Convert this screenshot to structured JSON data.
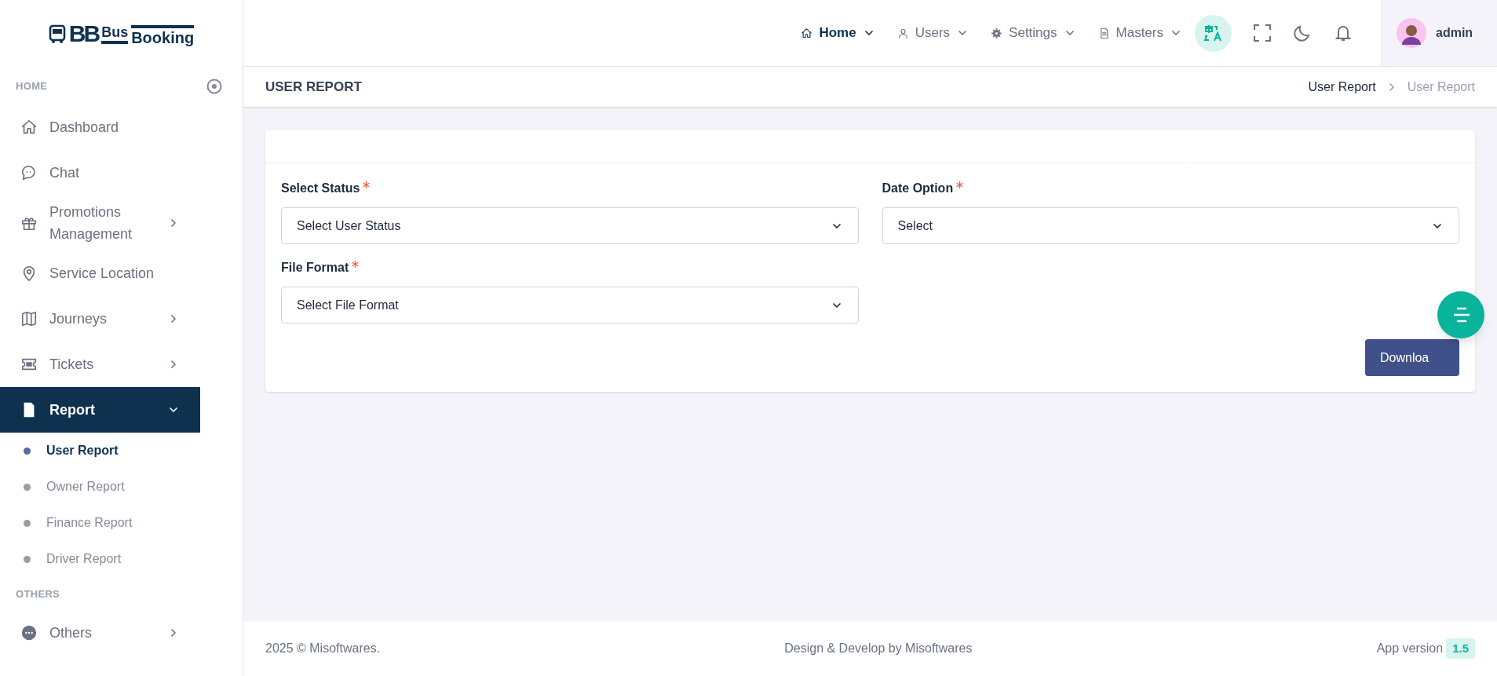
{
  "logo": {
    "mark": "BB",
    "word_top": "Bus",
    "word_bottom": "Booking"
  },
  "sidebar": {
    "sections": [
      {
        "title": "HOME",
        "items": [
          {
            "label": "Dashboard",
            "selected": false
          },
          {
            "label": "Chat",
            "selected": false
          },
          {
            "label": "Promotions Management",
            "expanded": false,
            "selected": false
          },
          {
            "label": "Service Location",
            "selected": false
          },
          {
            "label": "Journeys",
            "expanded": false,
            "selected": false
          },
          {
            "label": "Tickets",
            "expanded": false,
            "selected": false
          },
          {
            "label": "Report",
            "expanded": true,
            "selected": true,
            "children": [
              {
                "label": "User Report",
                "selected": true
              },
              {
                "label": "Owner Report",
                "selected": false
              },
              {
                "label": "Finance Report",
                "selected": false
              },
              {
                "label": "Driver Report",
                "selected": false
              }
            ]
          }
        ]
      },
      {
        "title": "OTHERS",
        "items": [
          {
            "label": "Others",
            "expanded": false,
            "selected": false
          }
        ]
      }
    ]
  },
  "topnav": {
    "menus": [
      {
        "label": "Home",
        "selected": true
      },
      {
        "label": "Users",
        "selected": false
      },
      {
        "label": "Settings",
        "selected": false
      },
      {
        "label": "Masters",
        "selected": false
      }
    ],
    "user": {
      "name": "admin"
    }
  },
  "page": {
    "title": "USER REPORT",
    "breadcrumb": [
      {
        "label": "User Report",
        "selected": false
      },
      {
        "label": "User Report",
        "selected": true
      }
    ]
  },
  "form": {
    "fields": [
      {
        "label": "Select Status",
        "required": true,
        "placeholder": "Select User Status"
      },
      {
        "label": "Date Option",
        "required": true,
        "placeholder": "Select"
      },
      {
        "label": "File Format",
        "required": true,
        "placeholder": "Select File Format"
      }
    ],
    "submit": "Downloa"
  },
  "footer": {
    "copyright": "2025 © Misoftwares.",
    "credit": "Design & Develop by Misoftwares",
    "version_label": "App version",
    "version": "1.5"
  }
}
